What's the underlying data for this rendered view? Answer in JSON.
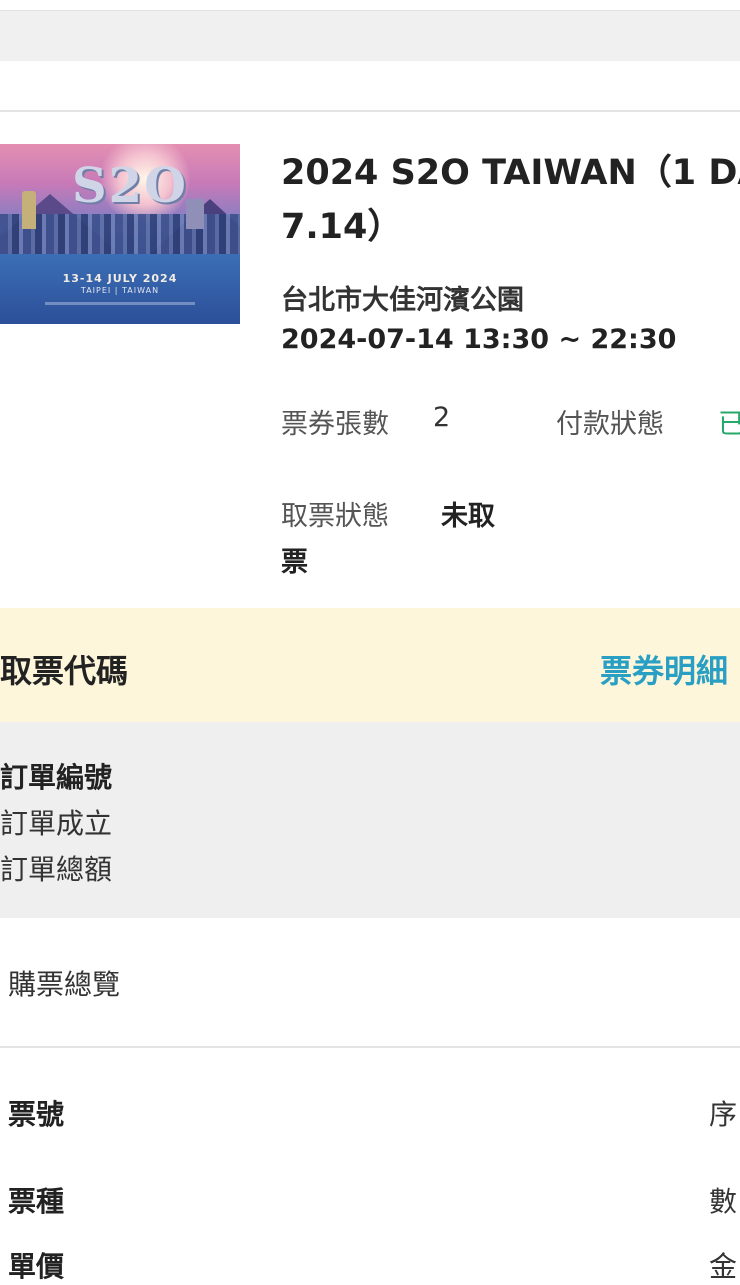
{
  "event": {
    "title_line1": "2024 S2O TAIWAN（1 DA",
    "title_line2": "7.14）",
    "venue": "台北市大佳河濱公園",
    "datetime": "2024-07-14 13:30 ~ 22:30",
    "poster": {
      "logo": "S2O",
      "date_text": "13-14 JULY 2024",
      "city_text": "TAIPEI | TAIWAN"
    }
  },
  "ticket_info": {
    "qty_label": "票券張數",
    "qty_value": "2",
    "payment_label": "付款狀態",
    "payment_value": "已",
    "pickup_label": "取票狀態",
    "pickup_value_line1": "未取",
    "pickup_value_line2": "票"
  },
  "band": {
    "pickup_code_label": "取票代碼",
    "details_link": "票券明細"
  },
  "order": {
    "number_label": "訂單編號",
    "created_label": "訂單成立",
    "total_label": "訂單總額"
  },
  "overview_label": "購票總覽",
  "table_rows": [
    {
      "left": "票號",
      "right": "序"
    },
    {
      "left": "票種",
      "right": "數"
    },
    {
      "left": "單價",
      "right": "金"
    }
  ],
  "colors": {
    "paid_status": "#27a86b",
    "details_link": "#2a9fc4",
    "band_bg": "#fdf6db"
  }
}
